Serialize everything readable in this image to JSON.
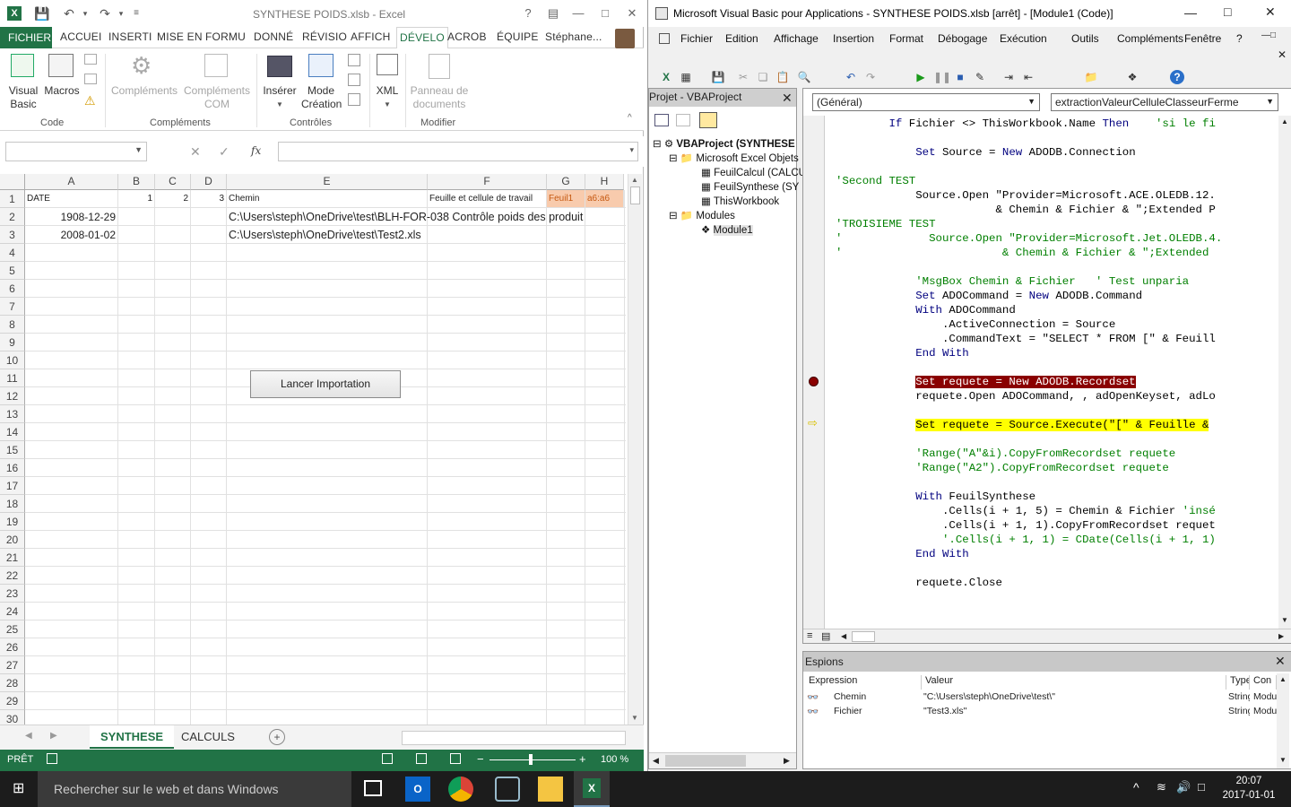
{
  "excel": {
    "title": "SYNTHESE POIDS.xlsb - Excel",
    "file_tab": "FICHIER",
    "tabs": [
      "ACCUEI",
      "INSERTI",
      "MISE EN",
      "FORMU",
      "DONNÉ",
      "RÉVISIO",
      "AFFICH",
      "DÉVELO",
      "ACROB",
      "ÉQUIPE"
    ],
    "user": "Stéphane...",
    "ribbon": {
      "visual_basic": "Visual\nBasic",
      "macros": "Macros",
      "complements": "Compléments",
      "complements_com": "Compléments\nCOM",
      "inserer": "Insérer",
      "mode_creation": "Mode\nCréation",
      "xml": "XML",
      "panneau": "Panneau de\ndocuments",
      "group_code": "Code",
      "group_complements": "Compléments",
      "group_controles": "Contrôles",
      "group_modifier": "Modifier"
    },
    "formula_bar": {
      "fx": "fx",
      "name_box": "",
      "formula": ""
    },
    "columns": [
      "A",
      "B",
      "C",
      "D",
      "E",
      "F",
      "G",
      "H"
    ],
    "row1": {
      "a": "DATE",
      "b": "1",
      "c": "2",
      "d": "3",
      "e": "Chemin",
      "f": "Feuille et cellule de travail",
      "g": "Feuil1",
      "h": "a6:a6"
    },
    "row2": {
      "a": "1908-12-29",
      "e": "C:\\Users\\steph\\OneDrive\\test\\BLH-FOR-038 Contrôle poids des produit"
    },
    "row3": {
      "a": "2008-01-02",
      "e": "C:\\Users\\steph\\OneDrive\\test\\Test2.xls"
    },
    "row_numbers": [
      "1",
      "2",
      "3",
      "4",
      "5",
      "6",
      "7",
      "8",
      "9",
      "10",
      "11",
      "12",
      "13",
      "14",
      "15",
      "16",
      "17",
      "18",
      "19",
      "20",
      "21",
      "22",
      "23",
      "24",
      "25",
      "26",
      "27",
      "28",
      "29",
      "30"
    ],
    "import_button": "Lancer Importation",
    "sheet_tabs": [
      "SYNTHESE",
      "CALCULS"
    ],
    "status": "PRÊT",
    "zoom": "100 %"
  },
  "vba": {
    "title": "Microsoft Visual Basic pour Applications - SYNTHESE POIDS.xlsb [arrêt] - [Module1 (Code)]",
    "menu": [
      "Fichier",
      "Edition",
      "Affichage",
      "Insertion",
      "Format",
      "Débogage",
      "Exécution",
      "Outils",
      "Compléments",
      "Fenêtre",
      "?"
    ],
    "project_title": "Projet - VBAProject",
    "tree": {
      "root": "VBAProject (SYNTHESE",
      "excel_objects": "Microsoft Excel Objets",
      "feuil_calcul": "FeuilCalcul (CALCU",
      "feuil_synthese": "FeuilSynthese (SY",
      "this_workbook": "ThisWorkbook",
      "modules": "Modules",
      "module1": "Module1"
    },
    "dropdown_left": "(Général)",
    "dropdown_right": "extractionValeurCelluleClasseurFerme",
    "code_lines": [
      "        If Fichier <> ThisWorkbook.Name Then    'si le fi",
      "",
      "            Set Source = New ADODB.Connection",
      "",
      "'Second TEST",
      "            Source.Open \"Provider=Microsoft.ACE.OLEDB.12.",
      "                        & Chemin & Fichier & \";Extended P",
      "'TROISIEME TEST",
      "'             Source.Open \"Provider=Microsoft.Jet.OLEDB.4.",
      "'                        & Chemin & Fichier & \";Extended",
      "",
      "            'MsgBox Chemin & Fichier   ' Test unparia",
      "            Set ADOCommand = New ADODB.Command",
      "            With ADOCommand",
      "                .ActiveConnection = Source",
      "                .CommandText = \"SELECT * FROM [\" & Feuill",
      "            End With",
      "",
      "            Set requete = New ADODB.Recordset",
      "            requete.Open ADOCommand, , adOpenKeyset, adLo",
      "",
      "            Set requete = Source.Execute(\"[\" & Feuille &",
      "",
      "            'Range(\"A\"&i).CopyFromRecordset requete",
      "            'Range(\"A2\").CopyFromRecordset requete",
      "",
      "            With FeuilSynthese",
      "                .Cells(i + 1, 5) = Chemin & Fichier 'insé",
      "                .Cells(i + 1, 1).CopyFromRecordset requet",
      "                '.Cells(i + 1, 1) = CDate(Cells(i + 1, 1)",
      "            End With",
      "",
      "            requete.Close"
    ],
    "watch": {
      "title": "Espions",
      "headers": [
        "Expression",
        "Valeur",
        "Type",
        "Con"
      ],
      "rows": [
        {
          "expr": "Chemin",
          "val": "\"C:\\Users\\steph\\OneDrive\\test\\\"",
          "type": "String",
          "ctx": "Modu"
        },
        {
          "expr": "Fichier",
          "val": "\"Test3.xls\"",
          "type": "String",
          "ctx": "Modu"
        }
      ]
    }
  },
  "taskbar": {
    "search_placeholder": "Rechercher sur le web et dans Windows",
    "time": "20:07",
    "date": "2017-01-01"
  },
  "colors": {
    "excel_green": "#217346",
    "breakpoint": "#8a0000",
    "exec_line": "#ffff00",
    "keyword": "#00007f",
    "comment": "#007f00"
  }
}
